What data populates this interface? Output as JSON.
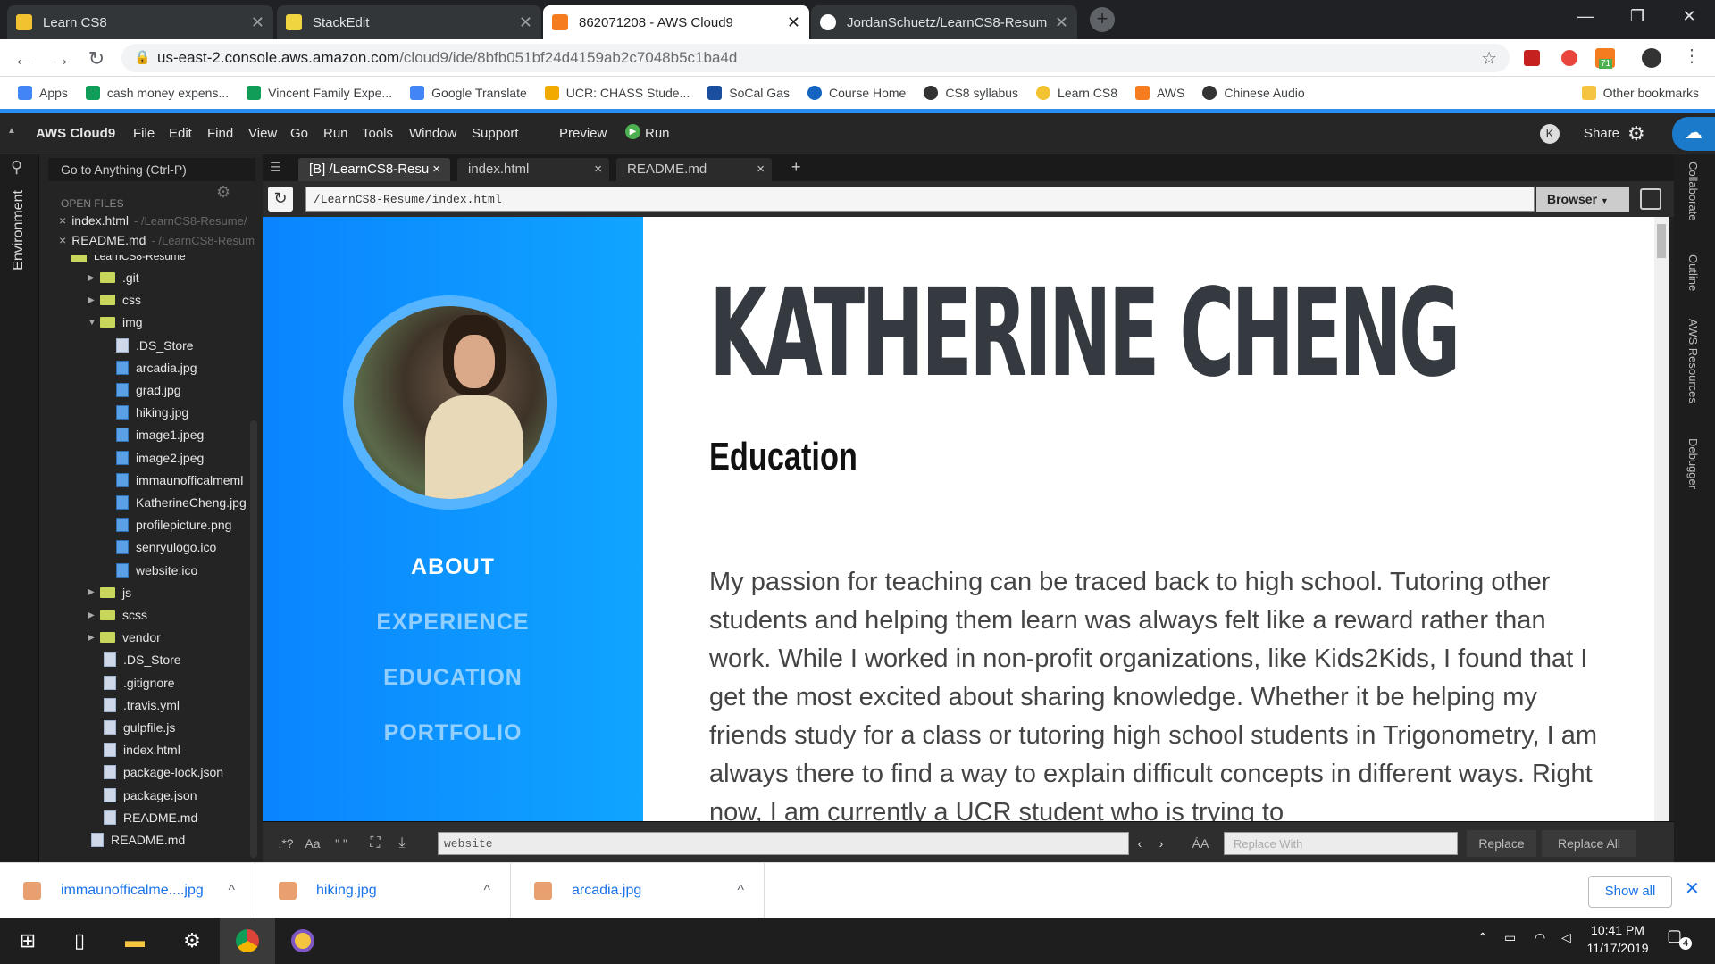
{
  "browser": {
    "tabs": [
      {
        "title": "Learn CS8",
        "icon": "smiley-icon",
        "color": "#f2c230"
      },
      {
        "title": "StackEdit",
        "icon": "stackedit-icon",
        "color": "#f0d440"
      },
      {
        "title": "862071208 - AWS Cloud9",
        "icon": "aws-cube-icon",
        "color": "#f57c1f"
      },
      {
        "title": "JordanSchuetz/LearnCS8-Resum",
        "icon": "github-icon",
        "color": "#ffffff"
      }
    ],
    "url_host": "us-east-2.console.aws.amazon.com",
    "url_path": "/cloud9/ide/8bfb051bf24d4159ab2c7048b5c1ba4d",
    "extension_badge": "71",
    "bookmarks": [
      {
        "label": "Apps",
        "color": "#4285f4"
      },
      {
        "label": "cash money expens...",
        "color": "#0f9d58"
      },
      {
        "label": "Vincent Family Expe...",
        "color": "#0f9d58"
      },
      {
        "label": "Google Translate",
        "color": "#4285f4"
      },
      {
        "label": "UCR: CHASS Stude...",
        "color": "#f2a900"
      },
      {
        "label": "SoCal Gas",
        "color": "#1a4fa0"
      },
      {
        "label": "Course Home",
        "color": "#1565c0"
      },
      {
        "label": "CS8 syllabus",
        "color": "#333333"
      },
      {
        "label": "Learn CS8",
        "color": "#f2c230"
      },
      {
        "label": "AWS",
        "color": "#f57c1f"
      },
      {
        "label": "Chinese Audio",
        "color": "#333333"
      }
    ],
    "other_bookmarks": "Other bookmarks"
  },
  "c9": {
    "brand": "AWS Cloud9",
    "menu": [
      "File",
      "Edit",
      "Find",
      "View",
      "Go",
      "Run",
      "Tools",
      "Window",
      "Support"
    ],
    "preview": "Preview",
    "run": "Run",
    "avatar_letter": "K",
    "share": "Share",
    "goto": "Go to Anything (Ctrl-P)",
    "environment": "Environment",
    "open_files_label": "OPEN FILES",
    "open_files": [
      {
        "name": "index.html",
        "path": "- /LearnCS8-Resume/"
      },
      {
        "name": "README.md",
        "path": "- /LearnCS8-Resum"
      }
    ],
    "tree_top": "LearnCS8-Resume",
    "tree": [
      {
        "name": ".git",
        "type": "folder",
        "open": false
      },
      {
        "name": "css",
        "type": "folder",
        "open": false
      },
      {
        "name": "img",
        "type": "folder",
        "open": true
      },
      {
        "name": ".DS_Store",
        "type": "file"
      },
      {
        "name": "arcadia.jpg",
        "type": "img"
      },
      {
        "name": "grad.jpg",
        "type": "img"
      },
      {
        "name": "hiking.jpg",
        "type": "img"
      },
      {
        "name": "image1.jpeg",
        "type": "img"
      },
      {
        "name": "image2.jpeg",
        "type": "img"
      },
      {
        "name": "immaunofficalmeml",
        "type": "img"
      },
      {
        "name": "KatherineCheng.jpg",
        "type": "img"
      },
      {
        "name": "profilepicture.png",
        "type": "img"
      },
      {
        "name": "senryulogo.ico",
        "type": "img"
      },
      {
        "name": "website.ico",
        "type": "img"
      },
      {
        "name": "js",
        "type": "folder",
        "open": false
      },
      {
        "name": "scss",
        "type": "folder",
        "open": false
      },
      {
        "name": "vendor",
        "type": "folder",
        "open": false
      },
      {
        "name": ".DS_Store",
        "type": "file"
      },
      {
        "name": ".gitignore",
        "type": "file"
      },
      {
        "name": ".travis.yml",
        "type": "file"
      },
      {
        "name": "gulpfile.js",
        "type": "file"
      },
      {
        "name": "index.html",
        "type": "file"
      },
      {
        "name": "package-lock.json",
        "type": "file"
      },
      {
        "name": "package.json",
        "type": "file"
      },
      {
        "name": "README.md",
        "type": "file"
      },
      {
        "name": "README.md",
        "type": "file"
      }
    ],
    "editor_tabs": [
      "[B] /LearnCS8-Resu",
      "index.html",
      "README.md"
    ],
    "preview_url": "/LearnCS8-Resume/index.html",
    "browser_btn": "Browser",
    "find_value": "website",
    "replace_placeholder": "Replace With",
    "replace": "Replace",
    "replace_all": "Replace All",
    "case_btn": "Aa",
    "aa_btn": "ÁA",
    "right_panels": [
      "Collaborate",
      "Outline",
      "AWS Resources",
      "Debugger"
    ]
  },
  "site": {
    "nav": [
      "ABOUT",
      "EXPERIENCE",
      "EDUCATION",
      "PORTFOLIO"
    ],
    "name": "KATHERINE CHENG",
    "heading": "Education",
    "bio": "My passion for teaching can be traced back to high school. Tutoring other students and helping them learn was always felt like a reward rather than work. While I worked in non-profit organizations, like Kids2Kids, I found that I get the most excited about sharing knowledge. Whether it be helping my friends study for a class or tutoring high school students in Trigonometry, I am always there to find a way to explain difficult concepts in different ways. Right now, I am currently a UCR student who is trying to"
  },
  "downloads": [
    "immaunofficalme....jpg",
    "hiking.jpg",
    "arcadia.jpg"
  ],
  "show_all": "Show all",
  "taskbar": {
    "time": "10:41 PM",
    "date": "11/17/2019",
    "notifications": "4"
  }
}
